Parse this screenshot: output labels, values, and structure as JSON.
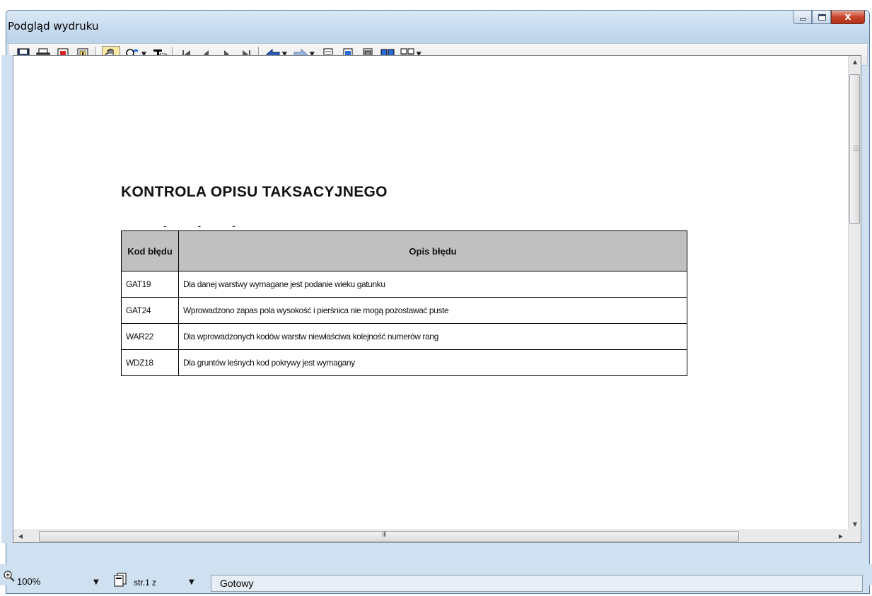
{
  "window": {
    "title": "Podgląd wydruku",
    "close_glyph": "x"
  },
  "toolbar": {
    "icons": [
      "save-icon",
      "print-icon",
      "export-pdf-icon",
      "page-info-icon",
      "hand-tool-icon",
      "find-icon",
      "text-select-icon",
      "first-page-icon",
      "previous-page-icon",
      "next-page-icon",
      "last-page-icon",
      "back-icon",
      "forward-icon",
      "single-page-icon",
      "page-width-icon",
      "whole-page-icon",
      "two-pages-icon",
      "multiple-pages-icon"
    ]
  },
  "report": {
    "title": "KONTROLA OPISU TAKSACYJNEGO",
    "dashes": "- - -",
    "columns": [
      "Kod błędu",
      "Opis błędu"
    ],
    "rows": [
      {
        "code": "GAT19",
        "desc": "Dla danej warstwy wymagane jest podanie wieku gatunku"
      },
      {
        "code": "GAT24",
        "desc": "Wprowadzono zapas  pola wysokość i pierśnica nie mogą  pozostawać puste"
      },
      {
        "code": "WAR22",
        "desc": "Dla wprowadzonych kodów warstw niewłaściwa kolejność numerów rang"
      },
      {
        "code": "WDZ18",
        "desc": "Dla gruntów leśnych kod pokrywy jest wymagany"
      }
    ]
  },
  "scrollbar": {
    "h_grip": "III"
  },
  "statusbar": {
    "zoom": "100%",
    "page": "str.1 z",
    "status": "Gotowy"
  }
}
